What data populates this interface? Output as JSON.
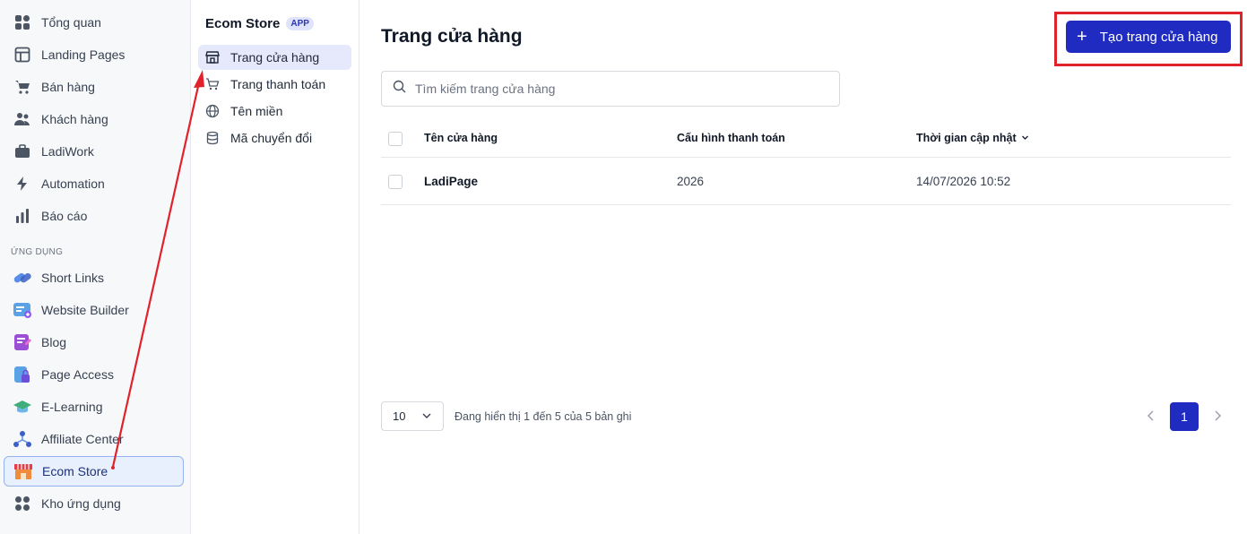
{
  "sidebar": {
    "items": [
      {
        "label": "Tổng quan",
        "icon": "dashboard-icon"
      },
      {
        "label": "Landing Pages",
        "icon": "layout-icon"
      },
      {
        "label": "Bán hàng",
        "icon": "cart-icon"
      },
      {
        "label": "Khách hàng",
        "icon": "users-icon"
      },
      {
        "label": "LadiWork",
        "icon": "briefcase-icon"
      },
      {
        "label": "Automation",
        "icon": "bolt-icon"
      },
      {
        "label": "Báo cáo",
        "icon": "bar-chart-icon"
      }
    ],
    "section_title": "ỨNG DỤNG",
    "apps": [
      {
        "label": "Short Links",
        "icon": "link-icon"
      },
      {
        "label": "Website Builder",
        "icon": "website-icon"
      },
      {
        "label": "Blog",
        "icon": "blog-icon"
      },
      {
        "label": "Page Access",
        "icon": "lock-icon"
      },
      {
        "label": "E-Learning",
        "icon": "graduation-icon"
      },
      {
        "label": "Affiliate Center",
        "icon": "network-icon"
      },
      {
        "label": "Ecom Store",
        "icon": "store-icon"
      },
      {
        "label": "Kho ứng dụng",
        "icon": "apps-icon"
      }
    ]
  },
  "submenu": {
    "title": "Ecom Store",
    "badge": "APP",
    "items": [
      {
        "label": "Trang cửa hàng",
        "icon": "store-icon"
      },
      {
        "label": "Trang thanh toán",
        "icon": "cart-icon"
      },
      {
        "label": "Tên miền",
        "icon": "globe-icon"
      },
      {
        "label": "Mã chuyển đổi",
        "icon": "database-icon"
      }
    ]
  },
  "main": {
    "title": "Trang cửa hàng",
    "create_button": "Tạo trang cửa hàng",
    "search_placeholder": "Tìm kiếm trang cửa hàng",
    "columns": [
      "Tên cửa hàng",
      "Cấu hình thanh toán",
      "Thời gian cập nhật"
    ],
    "rows": [
      {
        "name": "LadiPage",
        "payment": "2026",
        "updated": "14/07/2026 10:52"
      }
    ],
    "page_size": "10",
    "footer_info": "Đang hiển thị 1 đến 5 của 5 bản ghi",
    "current_page": "1"
  },
  "colors": {
    "accent": "#1f2bc1",
    "highlight": "#e0222a"
  }
}
